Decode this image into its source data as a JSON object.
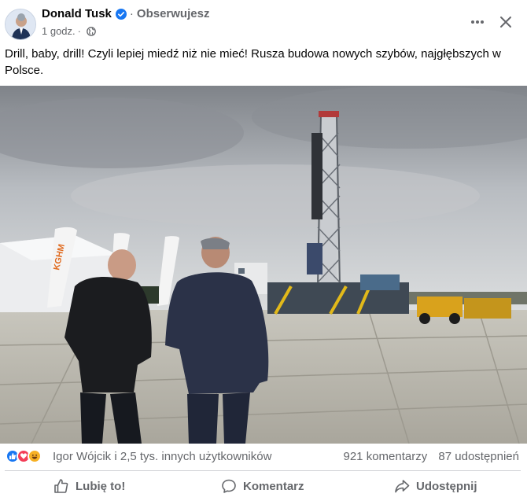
{
  "post": {
    "author": "Donald Tusk",
    "follow_status": "Obserwujesz",
    "separator": "·",
    "timestamp": "1 godz.",
    "meta_separator": "·",
    "text": "Drill, baby, drill! Czyli lepiej miedź niż nie mieć! Rusza budowa nowych szybów, najgłębszych w Polsce.",
    "photo_banner_text": "KGHM"
  },
  "icons": {
    "verified": "verified-badge-icon",
    "privacy": "globe-icon",
    "more": "more-options-icon",
    "close": "close-icon",
    "reactions": [
      "like-reaction-icon",
      "love-reaction-icon",
      "haha-reaction-icon"
    ]
  },
  "engagement": {
    "reactions_text": "Igor Wójcik i 2,5 tys. innych użytkowników",
    "comments": "921 komentarzy",
    "shares": "87 udostępnień"
  },
  "actions": {
    "like": "Lubię to!",
    "comment": "Komentarz",
    "share": "Udostępnij"
  },
  "colors": {
    "brand_blue": "#1877f2",
    "love_red": "#f33e58",
    "haha_yellow": "#f7b125",
    "secondary_text": "#65676b"
  }
}
